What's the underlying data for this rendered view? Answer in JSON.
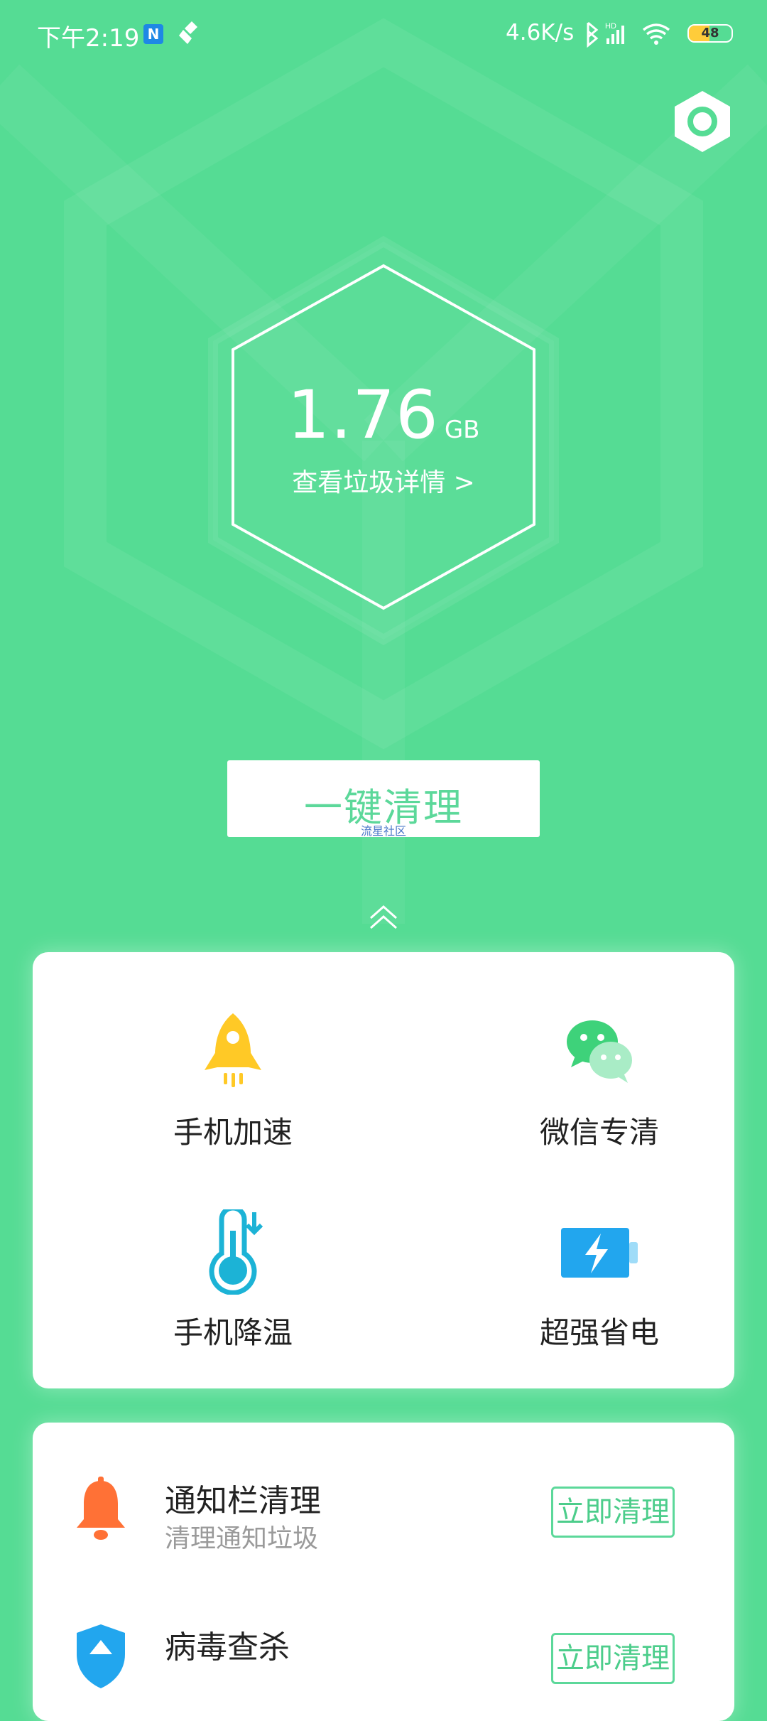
{
  "status_bar": {
    "time": "下午2:19",
    "n_badge": "N",
    "net_speed": "4.6K/s",
    "hd_label": "HD",
    "battery_level": "48",
    "battery_fraction": 0.48
  },
  "hero": {
    "junk_value": "1.76",
    "junk_unit": "GB",
    "details_link": "查看垃圾详情 >"
  },
  "clean_button": {
    "label": "一键清理",
    "watermark": "流星社区"
  },
  "features": [
    {
      "label": "手机加速",
      "icon": "rocket-icon"
    },
    {
      "label": "微信专清",
      "icon": "wechat-icon"
    },
    {
      "label": "手机降温",
      "icon": "thermometer-icon"
    },
    {
      "label": "超强省电",
      "icon": "battery-bolt-icon"
    }
  ],
  "list": [
    {
      "title": "通知栏清理",
      "subtitle": "清理通知垃圾",
      "button": "立即清理",
      "icon": "bell-icon"
    },
    {
      "title": "病毒查杀",
      "subtitle": "",
      "button": "立即清理",
      "icon": "shield-icon"
    }
  ],
  "colors": {
    "background": "#55dc94",
    "accent": "#5cd89a",
    "rocket": "#ffc926",
    "wechat": "#3ed27a",
    "thermo": "#1cb3d6",
    "battery": "#22a6ee",
    "bell": "#ff7136"
  }
}
